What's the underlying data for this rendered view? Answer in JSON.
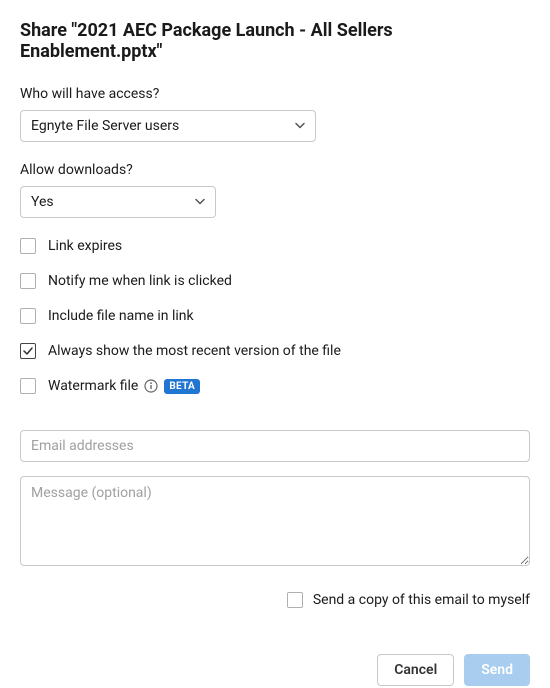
{
  "dialog": {
    "title": "Share \"2021 AEC Package Launch - All Sellers Enablement.pptx\""
  },
  "access": {
    "label": "Who will have access?",
    "selected": "Egnyte File Server users"
  },
  "downloads": {
    "label": "Allow downloads?",
    "selected": "Yes"
  },
  "options": {
    "link_expires": {
      "label": "Link expires",
      "checked": false
    },
    "notify_click": {
      "label": "Notify me when link is clicked",
      "checked": false
    },
    "include_filename": {
      "label": "Include file name in link",
      "checked": false
    },
    "recent_version": {
      "label": "Always show the most recent version of the file",
      "checked": true
    },
    "watermark": {
      "label": "Watermark file",
      "checked": false,
      "badge": "BETA"
    }
  },
  "email": {
    "placeholder": "Email addresses",
    "value": ""
  },
  "message": {
    "placeholder": "Message (optional)",
    "value": ""
  },
  "send_copy": {
    "label": "Send a copy of this email to myself",
    "checked": false
  },
  "buttons": {
    "cancel": "Cancel",
    "send": "Send"
  }
}
